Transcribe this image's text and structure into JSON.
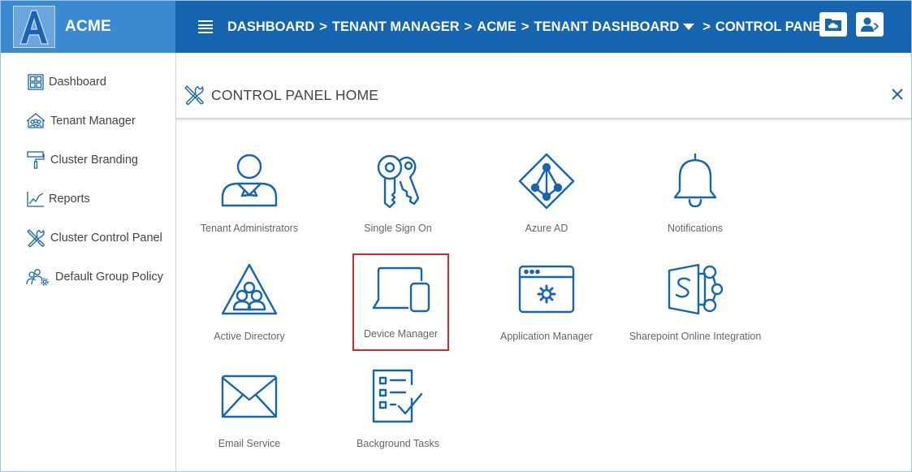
{
  "brand": {
    "logo_letter": "A",
    "name": "ACME"
  },
  "breadcrumb": [
    {
      "label": "DASHBOARD"
    },
    {
      "label": "TENANT MANAGER"
    },
    {
      "label": "ACME"
    },
    {
      "label": "TENANT DASHBOARD"
    },
    {
      "label": "CONTROL PANEL"
    }
  ],
  "breadcrumb_separator": ">",
  "top_actions": [
    {
      "icon": "cloud-folder-icon"
    },
    {
      "icon": "user-switch-icon"
    }
  ],
  "sidebar": {
    "items": [
      {
        "label": "Dashboard",
        "icon": "dashboard-grid-icon"
      },
      {
        "label": "Tenant Manager",
        "icon": "house-users-icon"
      },
      {
        "label": "Cluster Branding",
        "icon": "paint-roller-icon"
      },
      {
        "label": "Reports",
        "icon": "line-chart-icon"
      },
      {
        "label": "Cluster Control Panel",
        "icon": "tools-icon"
      },
      {
        "label": "Default Group Policy",
        "icon": "group-gear-icon"
      }
    ]
  },
  "panel": {
    "title": "CONTROL PANEL HOME",
    "tiles": [
      {
        "label": "Tenant Administrators",
        "icon": "admin-user-icon",
        "selected": false
      },
      {
        "label": "Single Sign On",
        "icon": "keys-icon",
        "selected": false
      },
      {
        "label": "Azure AD",
        "icon": "azure-ad-icon",
        "selected": false
      },
      {
        "label": "Notifications",
        "icon": "bell-icon",
        "selected": false
      },
      {
        "label": "Active Directory",
        "icon": "active-directory-icon",
        "selected": false
      },
      {
        "label": "Device Manager",
        "icon": "devices-icon",
        "selected": true
      },
      {
        "label": "Application Manager",
        "icon": "app-window-gear-icon",
        "selected": false
      },
      {
        "label": "Sharepoint Online Integration",
        "icon": "sharepoint-icon",
        "selected": false
      },
      {
        "label": "Email Service",
        "icon": "envelope-icon",
        "selected": false
      },
      {
        "label": "Background Tasks",
        "icon": "checklist-icon",
        "selected": false
      }
    ]
  },
  "colors": {
    "primary": "#1565b0",
    "brand_bg": "#3b8ad0",
    "selection": "#d9272a"
  }
}
